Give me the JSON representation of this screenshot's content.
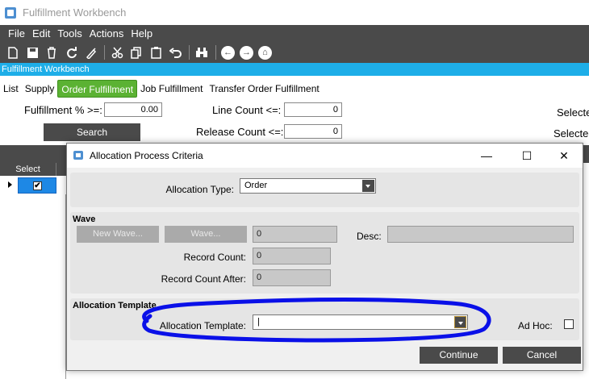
{
  "window": {
    "title": "Fulfillment Workbench"
  },
  "menubar": {
    "items": [
      "File",
      "Edit",
      "Tools",
      "Actions",
      "Help"
    ]
  },
  "header": {
    "title": "Fulfillment Workbench"
  },
  "tabs": [
    "List",
    "Supply",
    "Order Fulfillment",
    "Job Fulfillment",
    "Transfer Order Fulfillment"
  ],
  "active_tab": "Order Fulfillment",
  "search": {
    "fulfillment_label": "Fulfillment % >=:",
    "fulfillment_value": "0.00",
    "line_count_label": "Line Count <=:",
    "line_count_value": "0",
    "release_count_label": "Release Count <=:",
    "release_count_value": "0",
    "search_button": "Search",
    "selected_1": "Selecte",
    "selected_2": "Selected"
  },
  "grid": {
    "select_header": "Select",
    "row_checked": "✔"
  },
  "dialog": {
    "title": "Allocation Process Criteria",
    "allocation_type_label": "Allocation Type:",
    "allocation_type_value": "Order",
    "wave": {
      "section_title": "Wave",
      "new_wave_button": "New Wave...",
      "wave_button": "Wave...",
      "wave_id_value": "0",
      "desc_label": "Desc:",
      "desc_value": "",
      "record_count_label": "Record Count:",
      "record_count_value": "0",
      "record_count_after_label": "Record Count After:",
      "record_count_after_value": "0"
    },
    "template": {
      "section_title": "Allocation Template",
      "label": "Allocation Template:",
      "value": "|",
      "adhoc_label": "Ad Hoc:"
    },
    "continue_button": "Continue",
    "cancel_button": "Cancel"
  },
  "colors": {
    "accent_blue": "#1eaee8",
    "tab_green": "#5bb233",
    "toolbar_dark": "#4a4a4a",
    "annotation_blue": "#0a10e8"
  }
}
